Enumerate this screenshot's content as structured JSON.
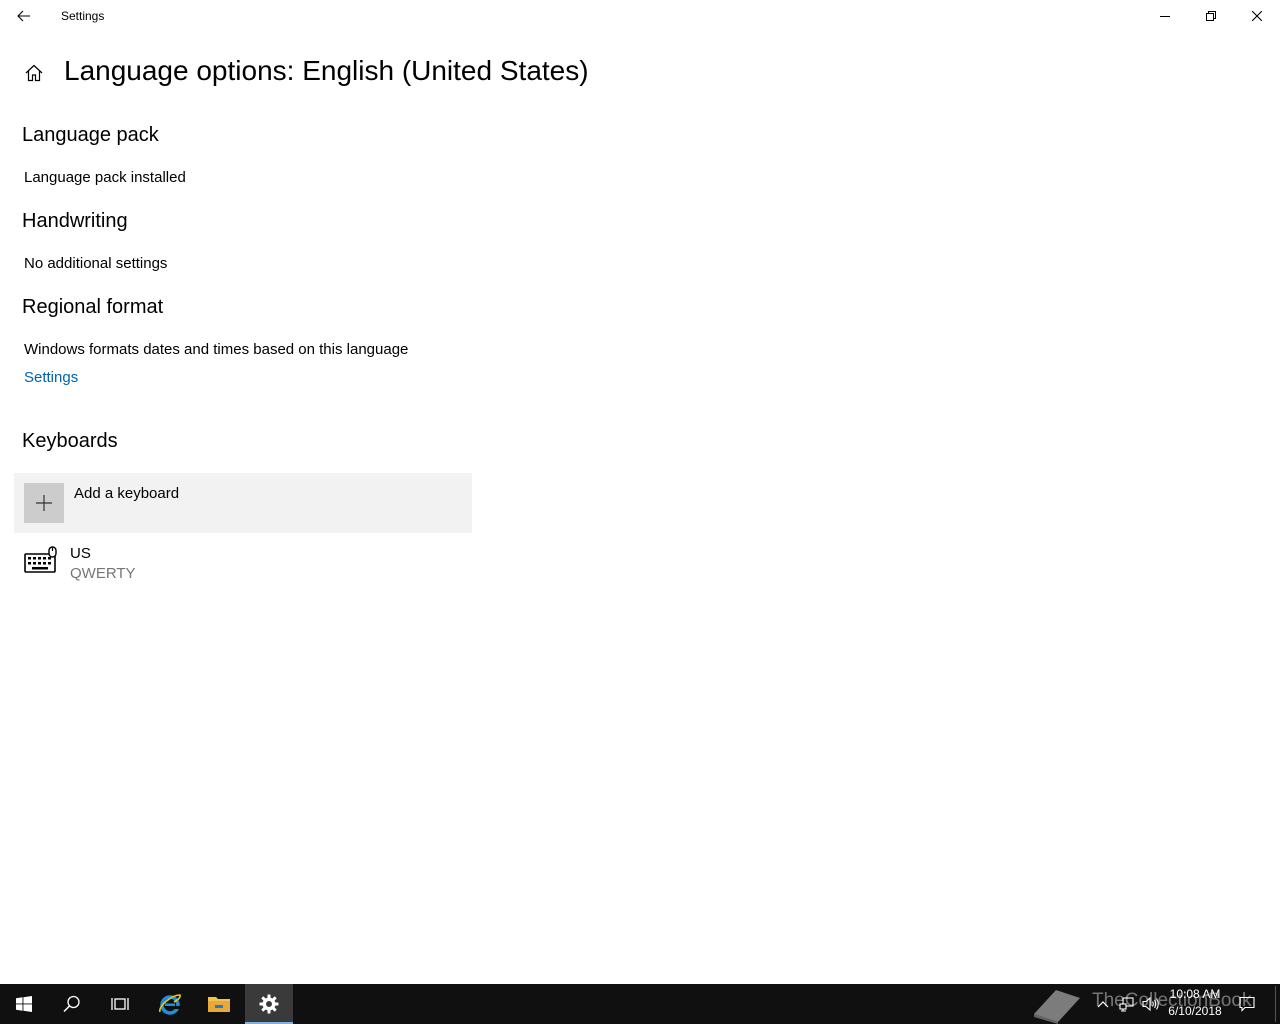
{
  "window": {
    "title": "Settings"
  },
  "header": {
    "title": "Language options: English (United States)"
  },
  "sections": {
    "language_pack": {
      "title": "Language pack",
      "status": "Language pack installed"
    },
    "handwriting": {
      "title": "Handwriting",
      "status": "No additional settings"
    },
    "regional_format": {
      "title": "Regional format",
      "description": "Windows formats dates and times based on this language",
      "link": "Settings"
    },
    "keyboards": {
      "title": "Keyboards",
      "add_label": "Add a keyboard",
      "items": [
        {
          "name": "US",
          "layout": "QWERTY"
        }
      ]
    }
  },
  "taskbar": {
    "clock_time": "10:08 AM",
    "clock_date": "6/10/2018",
    "watermark": "TheCollectionBook"
  },
  "colors": {
    "accent_link": "#0063b1",
    "taskbar_bg": "#101010",
    "add_button_bg": "#f2f2f2"
  }
}
